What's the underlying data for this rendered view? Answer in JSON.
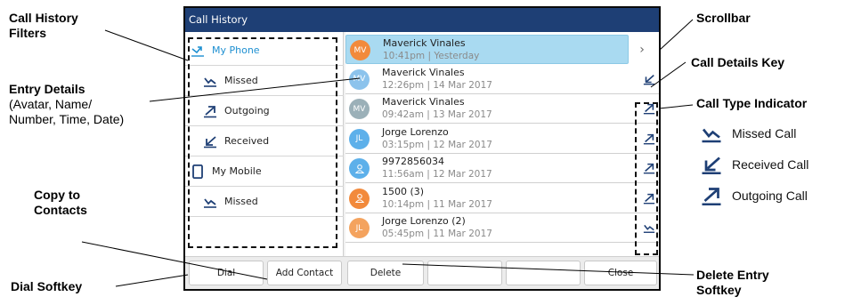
{
  "screen": {
    "title": "Call History",
    "filters": [
      {
        "label": "My Phone",
        "icon": "phone-calls-icon",
        "active": true,
        "level": "top"
      },
      {
        "label": "Missed",
        "icon": "missed-call-icon",
        "active": false,
        "level": "sub"
      },
      {
        "label": "Outgoing",
        "icon": "outgoing-call-icon",
        "active": false,
        "level": "sub"
      },
      {
        "label": "Received",
        "icon": "received-call-icon",
        "active": false,
        "level": "sub"
      },
      {
        "label": "My Mobile",
        "icon": "mobile-phone-icon",
        "active": false,
        "level": "top"
      },
      {
        "label": "Missed",
        "icon": "missed-call-icon",
        "active": false,
        "level": "sub"
      }
    ],
    "entries": [
      {
        "avatar": "MV",
        "avatar_color": "#f28a3c",
        "name": "Maverick Vinales",
        "meta": "10:41pm | Yesterday",
        "selected": true,
        "type": "missed"
      },
      {
        "avatar": "MV",
        "avatar_color": "#8cc3ec",
        "name": "Maverick Vinales",
        "meta": "12:26pm | 14 Mar 2017",
        "selected": false,
        "type": "received"
      },
      {
        "avatar": "MV",
        "avatar_color": "#9bb0b8",
        "name": "Maverick Vinales",
        "meta": "09:42am | 13 Mar 2017",
        "selected": false,
        "type": "outgoing"
      },
      {
        "avatar": "JL",
        "avatar_color": "#5db0ea",
        "name": "Jorge Lorenzo",
        "meta": "03:15pm | 12 Mar 2017",
        "selected": false,
        "type": "outgoing"
      },
      {
        "avatar": "person",
        "avatar_color": "#5db0ea",
        "name": "9972856034",
        "meta": "11:56am | 12 Mar 2017",
        "selected": false,
        "type": "outgoing"
      },
      {
        "avatar": "person",
        "avatar_color": "#f28a3c",
        "name": "1500 (3)",
        "meta": "10:14pm | 11 Mar 2017",
        "selected": false,
        "type": "outgoing"
      },
      {
        "avatar": "JL",
        "avatar_color": "#f4a35e",
        "name": "Jorge Lorenzo (2)",
        "meta": "05:45pm | 11 Mar 2017",
        "selected": false,
        "type": "missed"
      }
    ],
    "details_chevron": "›",
    "softkeys": {
      "dial": "Dial",
      "add_contact": "Add Contact",
      "delete": "Delete",
      "close": "Close"
    }
  },
  "callouts": {
    "call_history_filters": "Call History\nFilters",
    "entry_details_title": "Entry Details",
    "entry_details_sub": "(Avatar, Name/\nNumber, Time, Date)",
    "copy_to_contacts": "Copy to\nContacts",
    "dial_softkey": "Dial Softkey",
    "scrollbar": "Scrollbar",
    "call_details_key": "Call Details Key",
    "call_type_indicator": "Call Type Indicator",
    "delete_entry_softkey": "Delete Entry\nSoftkey"
  },
  "legend": [
    {
      "label": "Missed Call",
      "icon": "missed-call-icon"
    },
    {
      "label": "Received Call",
      "icon": "received-call-icon"
    },
    {
      "label": "Outgoing Call",
      "icon": "outgoing-call-icon"
    }
  ],
  "colors": {
    "title_bar": "#1e3f75",
    "accent": "#1d8fd1",
    "selected_row": "#a9daf1",
    "icon_dark": "#1e3f75"
  }
}
